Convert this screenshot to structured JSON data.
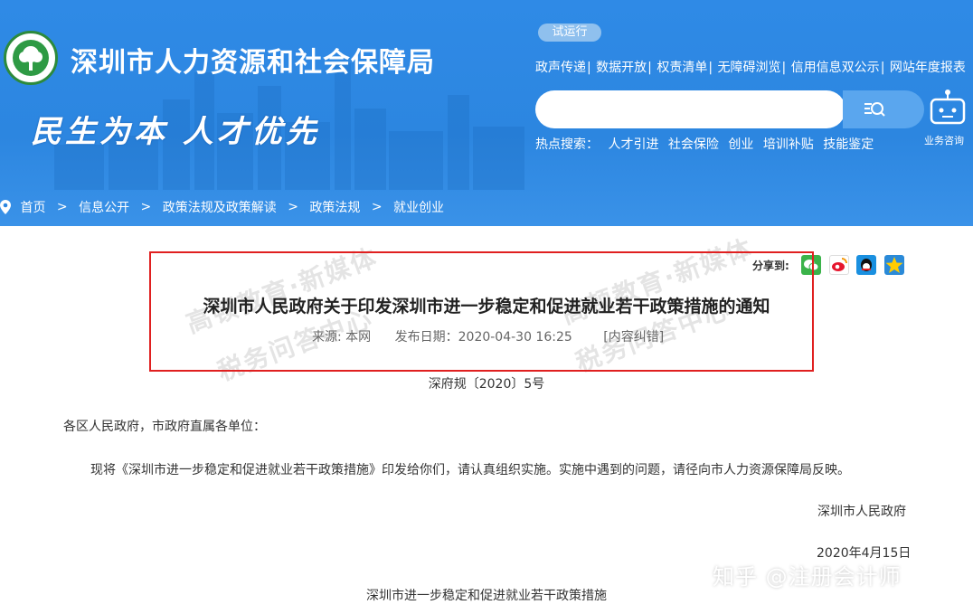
{
  "header": {
    "site_title": "深圳市人力资源和社会保障局",
    "slogan": "民生为本 人才优先",
    "beta_badge": "试运行",
    "top_links": [
      "政声传递",
      "数据开放",
      "权责清单",
      "无障碍浏览",
      "信用信息双公示",
      "网站年度报表"
    ],
    "search": {
      "placeholder": ""
    },
    "hot_search_label": "热点搜索：",
    "hot_search_items": [
      "人才引进",
      "社会保险",
      "创业",
      "培训补贴",
      "技能鉴定"
    ],
    "robot_label": "业务咨询"
  },
  "breadcrumb": [
    "首页",
    "信息公开",
    "政策法规及政策解读",
    "政策法规",
    "就业创业"
  ],
  "article": {
    "share_label": "分享到:",
    "share_icons": [
      "wechat-icon",
      "weibo-icon",
      "qq-icon",
      "qzone-icon"
    ],
    "title": "深圳市人民政府关于印发深圳市进一步稳定和促进就业若干政策措施的通知",
    "source": "来源: 本网",
    "publish_date": "发布日期：2020-04-30 16:25",
    "error_link": "[内容纠错]",
    "doc_number": "深府规〔2020〕5号",
    "salutation": "各区人民政府，市政府直属各单位：",
    "body": "现将《深圳市进一步稳定和促进就业若干政策措施》印发给你们，请认真组织实施。实施中遇到的问题，请径向市人力资源保障局反映。",
    "signature": "深圳市人民政府",
    "sign_date": "2020年4月15日",
    "subtitle": "深圳市进一步稳定和促进就业若干政策措施"
  },
  "watermarks": {
    "line1": "高顿教育·新媒体",
    "line2": "税务问答中心"
  },
  "overlay_watermark": "知乎 @注册会计师",
  "colors": {
    "header_blue": "#2c86e0",
    "highlight_red": "#e02020"
  }
}
